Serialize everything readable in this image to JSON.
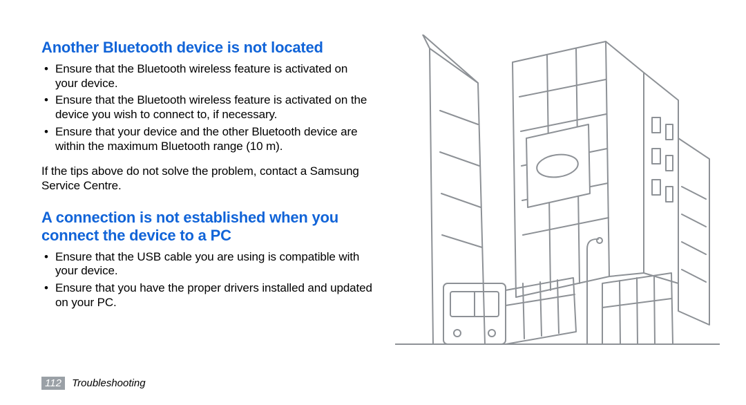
{
  "section1": {
    "heading": "Another Bluetooth device is not located",
    "bullets": [
      "Ensure that the Bluetooth wireless feature is activated on your device.",
      "Ensure that the Bluetooth wireless feature is activated on the device you wish to connect to, if necessary.",
      "Ensure that your device and the other Bluetooth device are within the maximum Bluetooth range (10 m)."
    ],
    "note": "If the tips above do not solve the problem, contact a Samsung Service Centre."
  },
  "section2": {
    "heading": "A connection is not established when you connect the device to a PC",
    "bullets": [
      "Ensure that the USB cable you are using is compatible with your device.",
      "Ensure that you have the proper drivers installed and updated on your PC."
    ]
  },
  "footer": {
    "page": "112",
    "title": "Troubleshooting"
  },
  "illustration_label": "cityscape-sketch"
}
